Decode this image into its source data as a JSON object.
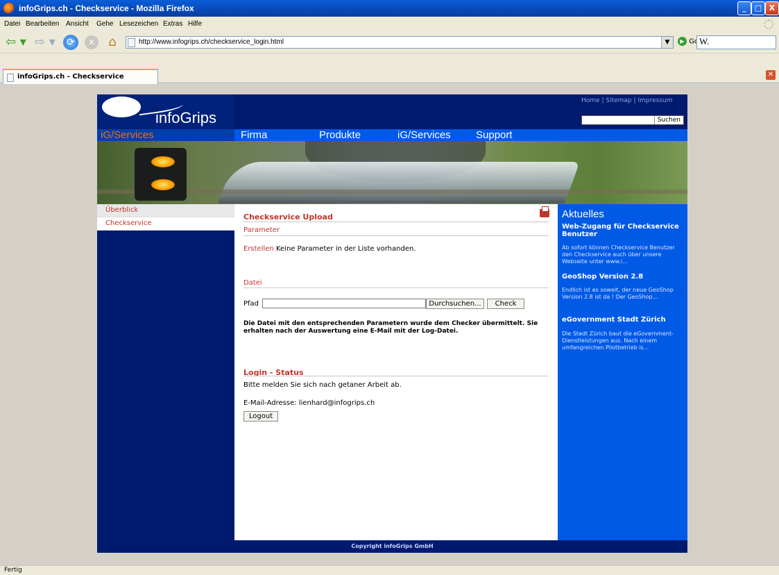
{
  "window": {
    "title": "infoGrips.ch - Checkservice - Mozilla Firefox",
    "btn_min": "_",
    "btn_max": "□",
    "btn_close": "X"
  },
  "menubar": {
    "items": [
      "Datei",
      "Bearbeiten",
      "Ansicht",
      "Gehe",
      "Lesezeichen",
      "Extras",
      "Hilfe"
    ]
  },
  "toolbar": {
    "url": "http://www.infogrips.ch/checkservice_login.html",
    "go_label": "Go",
    "search_value": "W."
  },
  "tabs": [
    {
      "label": "infoGrips.ch - Checkservice"
    }
  ],
  "site": {
    "logo_text": "infoGrips",
    "top_links": [
      "Home",
      "Sitemap",
      "Impressum"
    ],
    "top_sep": "|",
    "search_button": "Suchen",
    "section_title": "iG/Services",
    "nav": [
      "Firma",
      "Produkte",
      "iG/Services",
      "Support"
    ],
    "sidebar": [
      "Überblick",
      "Checkservice"
    ]
  },
  "main": {
    "title": "Checkservice Upload",
    "parameter_heading": "Parameter",
    "create_link": "Erstellen",
    "no_params": "Keine Parameter in der Liste vorhanden.",
    "file_heading": "Datei",
    "path_label": "Pfad",
    "path_value": "",
    "browse_button": "Durchsuchen...",
    "check_button": "Check",
    "notice": "Die Datei mit den entsprechenden Parametern wurde dem Checker übermittelt. Sie erhalten nach der Auswertung eine E-Mail mit der Log-Datei.",
    "login_heading": "Login - Status",
    "logout_hint": "Bitte melden Sie sich nach getaner Arbeit ab.",
    "email_line": "E-Mail-Adresse: lienhard@infogrips.ch",
    "logout_button": "Logout"
  },
  "news": {
    "heading": "Aktuelles",
    "items": [
      {
        "title": "Web-Zugang für Checkservice Benutzer",
        "text": "Ab sofort können Checkservice Benutzer den Checkservice auch über unsere Webseite unter www.i..."
      },
      {
        "title": "GeoShop Version 2.8",
        "text": "Endlich ist es soweit, der neue GeoShop Version 2.8 ist da ! Der GeoShop..."
      },
      {
        "title": "eGovernment Stadt Zürich",
        "text": "Die Stadt Zürich baut die eGovernment-Dienstleistungen aus. Nach einem umfangreichen Pilotbetrieb is..."
      }
    ]
  },
  "footer": {
    "text": "Copyright infoGrips GmbH"
  },
  "status": {
    "text": "Fertig"
  }
}
